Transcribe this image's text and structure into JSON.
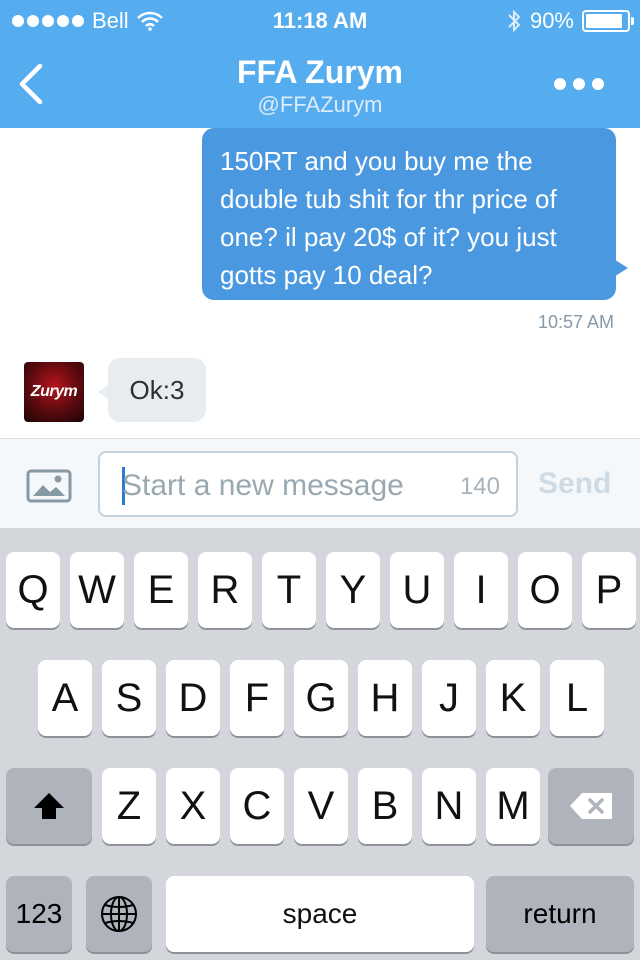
{
  "status_bar": {
    "carrier": "Bell",
    "time": "11:18 AM",
    "battery_percent": "90%",
    "battery_level": 0.9,
    "signal_dots": 5
  },
  "nav": {
    "title": "FFA Zurym",
    "handle": "@FFAZurym"
  },
  "messages": [
    {
      "direction": "outgoing",
      "text": "150RT and you buy me the double tub shit for thr price of one? il pay 20$ of it? you just gotts pay 10 deal?",
      "time": "10:57 AM"
    },
    {
      "direction": "incoming",
      "text": "Ok:3",
      "avatar_text": "Zurym"
    }
  ],
  "compose": {
    "placeholder": "Start a new message",
    "char_count": "140",
    "send_label": "Send"
  },
  "keyboard": {
    "row1": [
      "Q",
      "W",
      "E",
      "R",
      "T",
      "Y",
      "U",
      "I",
      "O",
      "P"
    ],
    "row2": [
      "A",
      "S",
      "D",
      "F",
      "G",
      "H",
      "J",
      "K",
      "L"
    ],
    "row3": [
      "Z",
      "X",
      "C",
      "V",
      "B",
      "N",
      "M"
    ],
    "numbers_label": "123",
    "space_label": "space",
    "return_label": "return"
  },
  "colors": {
    "header": "#55acee",
    "outgoing_bubble": "#4a98df",
    "incoming_bubble": "#e6ecf0",
    "keyboard_bg": "#d3d6db"
  }
}
